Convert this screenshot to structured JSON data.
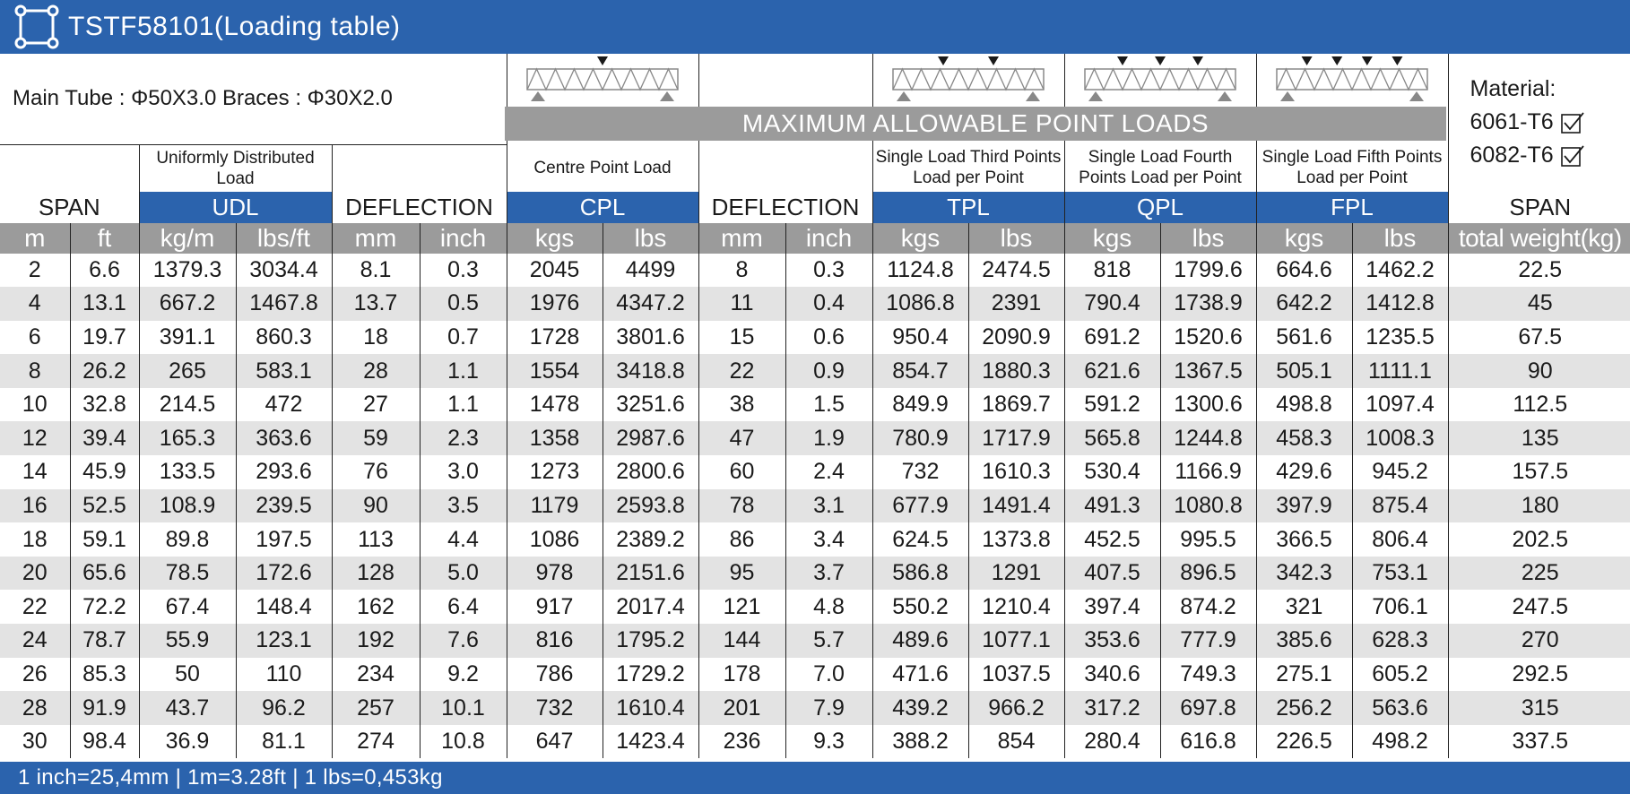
{
  "title": "TSTF58101(Loading table)",
  "icons": {
    "logo": "truss-square-icon",
    "checkbox": "checked-box-icon",
    "load_diagram": "truss-load-diagram"
  },
  "colors": {
    "header_blue": "#2b63ad",
    "band_gray": "#9b9b9b",
    "row_alt": "#e3e3e3"
  },
  "spec": "Main Tube : Φ50X3.0   Braces : Φ30X2.0",
  "band": "MAXIMUM ALLOWABLE POINT LOADS",
  "material": {
    "label": "Material:",
    "items": [
      "6061-T6",
      "6082-T6"
    ]
  },
  "descriptions": {
    "udl": "Uniformly Distributed Load",
    "cpl": "Centre Point Load",
    "tpl": "Single Load Third Points Load per Point",
    "qpl": "Single Load Fourth Points Load per Point",
    "fpl": "Single Load Fifth Points Load per Point"
  },
  "codes": {
    "span": "SPAN",
    "udl": "UDL",
    "deflection1": "DEFLECTION",
    "cpl": "CPL",
    "deflection2": "DEFLECTION",
    "tpl": "TPL",
    "qpl": "QPL",
    "fpl": "FPL",
    "span2": "SPAN"
  },
  "units": [
    "m",
    "ft",
    "kg/m",
    "lbs/ft",
    "mm",
    "inch",
    "kgs",
    "lbs",
    "mm",
    "inch",
    "kgs",
    "lbs",
    "kgs",
    "lbs",
    "kgs",
    "lbs",
    "total weight(kg)"
  ],
  "rows": [
    [
      "2",
      "6.6",
      "1379.3",
      "3034.4",
      "8.1",
      "0.3",
      "2045",
      "4499",
      "8",
      "0.3",
      "1124.8",
      "2474.5",
      "818",
      "1799.6",
      "664.6",
      "1462.2",
      "22.5"
    ],
    [
      "4",
      "13.1",
      "667.2",
      "1467.8",
      "13.7",
      "0.5",
      "1976",
      "4347.2",
      "11",
      "0.4",
      "1086.8",
      "2391",
      "790.4",
      "1738.9",
      "642.2",
      "1412.8",
      "45"
    ],
    [
      "6",
      "19.7",
      "391.1",
      "860.3",
      "18",
      "0.7",
      "1728",
      "3801.6",
      "15",
      "0.6",
      "950.4",
      "2090.9",
      "691.2",
      "1520.6",
      "561.6",
      "1235.5",
      "67.5"
    ],
    [
      "8",
      "26.2",
      "265",
      "583.1",
      "28",
      "1.1",
      "1554",
      "3418.8",
      "22",
      "0.9",
      "854.7",
      "1880.3",
      "621.6",
      "1367.5",
      "505.1",
      "1111.1",
      "90"
    ],
    [
      "10",
      "32.8",
      "214.5",
      "472",
      "27",
      "1.1",
      "1478",
      "3251.6",
      "38",
      "1.5",
      "849.9",
      "1869.7",
      "591.2",
      "1300.6",
      "498.8",
      "1097.4",
      "112.5"
    ],
    [
      "12",
      "39.4",
      "165.3",
      "363.6",
      "59",
      "2.3",
      "1358",
      "2987.6",
      "47",
      "1.9",
      "780.9",
      "1717.9",
      "565.8",
      "1244.8",
      "458.3",
      "1008.3",
      "135"
    ],
    [
      "14",
      "45.9",
      "133.5",
      "293.6",
      "76",
      "3.0",
      "1273",
      "2800.6",
      "60",
      "2.4",
      "732",
      "1610.3",
      "530.4",
      "1166.9",
      "429.6",
      "945.2",
      "157.5"
    ],
    [
      "16",
      "52.5",
      "108.9",
      "239.5",
      "90",
      "3.5",
      "1179",
      "2593.8",
      "78",
      "3.1",
      "677.9",
      "1491.4",
      "491.3",
      "1080.8",
      "397.9",
      "875.4",
      "180"
    ],
    [
      "18",
      "59.1",
      "89.8",
      "197.5",
      "113",
      "4.4",
      "1086",
      "2389.2",
      "86",
      "3.4",
      "624.5",
      "1373.8",
      "452.5",
      "995.5",
      "366.5",
      "806.4",
      "202.5"
    ],
    [
      "20",
      "65.6",
      "78.5",
      "172.6",
      "128",
      "5.0",
      "978",
      "2151.6",
      "95",
      "3.7",
      "586.8",
      "1291",
      "407.5",
      "896.5",
      "342.3",
      "753.1",
      "225"
    ],
    [
      "22",
      "72.2",
      "67.4",
      "148.4",
      "162",
      "6.4",
      "917",
      "2017.4",
      "121",
      "4.8",
      "550.2",
      "1210.4",
      "397.4",
      "874.2",
      "321",
      "706.1",
      "247.5"
    ],
    [
      "24",
      "78.7",
      "55.9",
      "123.1",
      "192",
      "7.6",
      "816",
      "1795.2",
      "144",
      "5.7",
      "489.6",
      "1077.1",
      "353.6",
      "777.9",
      "385.6",
      "628.3",
      "270"
    ],
    [
      "26",
      "85.3",
      "50",
      "110",
      "234",
      "9.2",
      "786",
      "1729.2",
      "178",
      "7.0",
      "471.6",
      "1037.5",
      "340.6",
      "749.3",
      "275.1",
      "605.2",
      "292.5"
    ],
    [
      "28",
      "91.9",
      "43.7",
      "96.2",
      "257",
      "10.1",
      "732",
      "1610.4",
      "201",
      "7.9",
      "439.2",
      "966.2",
      "317.2",
      "697.8",
      "256.2",
      "563.6",
      "315"
    ],
    [
      "30",
      "98.4",
      "36.9",
      "81.1",
      "274",
      "10.8",
      "647",
      "1423.4",
      "236",
      "9.3",
      "388.2",
      "854",
      "280.4",
      "616.8",
      "226.5",
      "498.2",
      "337.5"
    ]
  ],
  "footer": "1 inch=25,4mm  |  1m=3.28ft  |  1 lbs=0,453kg"
}
